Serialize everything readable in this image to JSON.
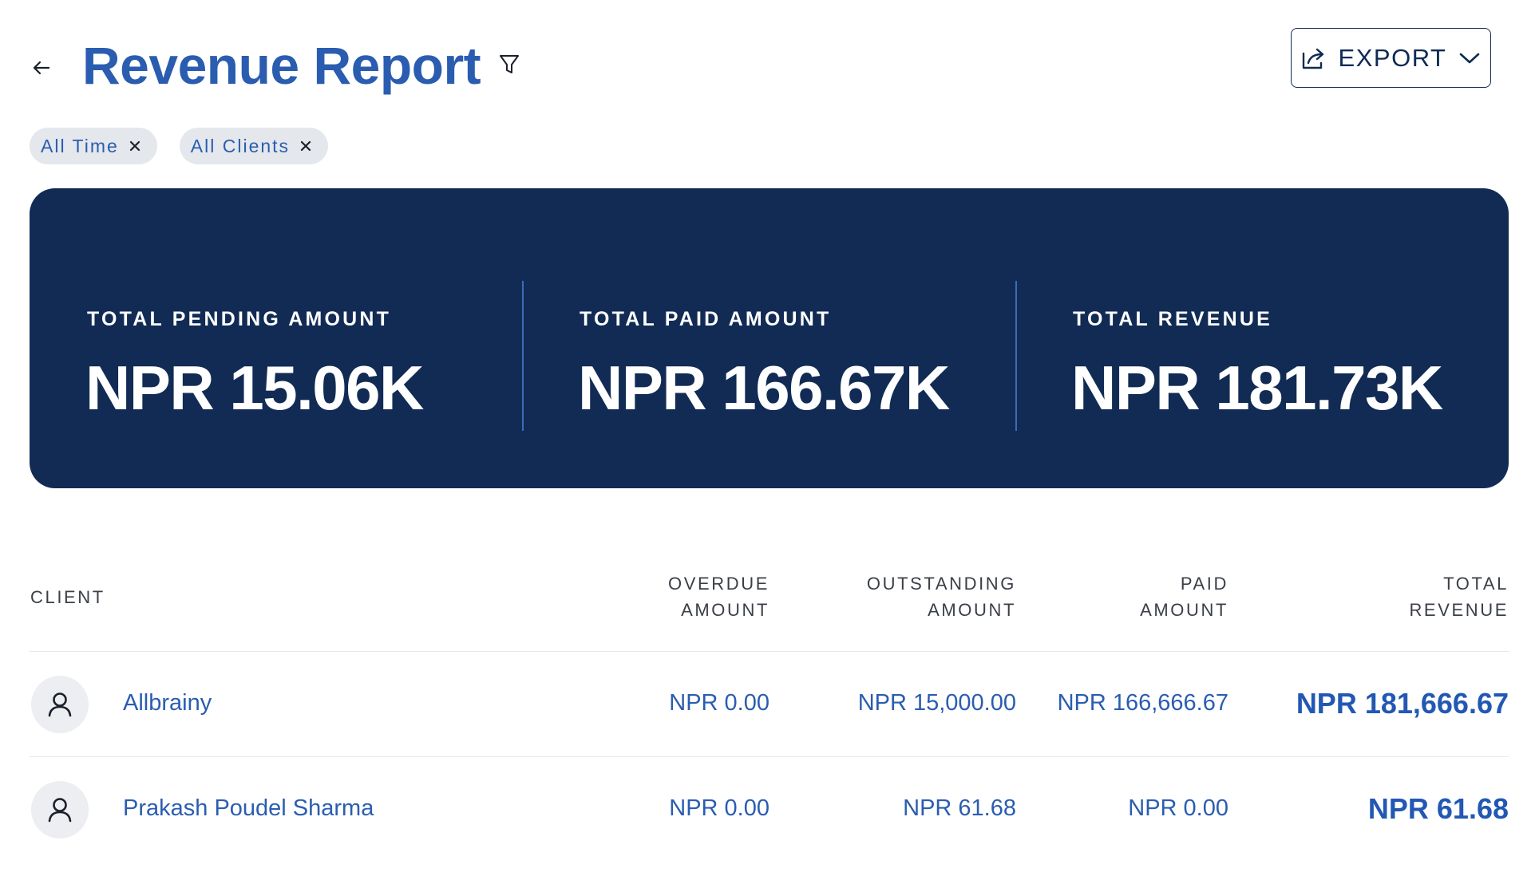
{
  "header": {
    "title": "Revenue Report",
    "export_label": "EXPORT"
  },
  "filters": [
    {
      "label": "All Time"
    },
    {
      "label": "All Clients"
    }
  ],
  "summary": {
    "pending": {
      "label": "TOTAL PENDING AMOUNT",
      "value": "NPR 15.06K"
    },
    "paid": {
      "label": "TOTAL PAID AMOUNT",
      "value": "NPR 166.67K"
    },
    "revenue": {
      "label": "TOTAL REVENUE",
      "value": "NPR 181.73K"
    }
  },
  "table": {
    "columns": {
      "client": "CLIENT",
      "overdue": "OVERDUE\nAMOUNT",
      "outstanding": "OUTSTANDING\nAMOUNT",
      "paid": "PAID\nAMOUNT",
      "total": "TOTAL\nREVENUE"
    },
    "rows": [
      {
        "client": "Allbrainy",
        "overdue": "NPR 0.00",
        "outstanding": "NPR 15,000.00",
        "paid": "NPR 166,666.67",
        "total": "NPR 181,666.67"
      },
      {
        "client": "Prakash Poudel Sharma",
        "overdue": "NPR 0.00",
        "outstanding": "NPR 61.68",
        "paid": "NPR 0.00",
        "total": "NPR 61.68"
      }
    ]
  },
  "colors": {
    "primary_text": "#2a5db0",
    "banner_bg": "#112b54",
    "chip_bg": "#e4e7ec",
    "divider": "#3f6bb7"
  },
  "icons": {
    "back": "arrow-left-icon",
    "filter": "funnel-icon",
    "export": "share-export-icon",
    "dropdown": "chevron-down-icon",
    "chip_close": "close-icon",
    "avatar": "user-icon"
  }
}
